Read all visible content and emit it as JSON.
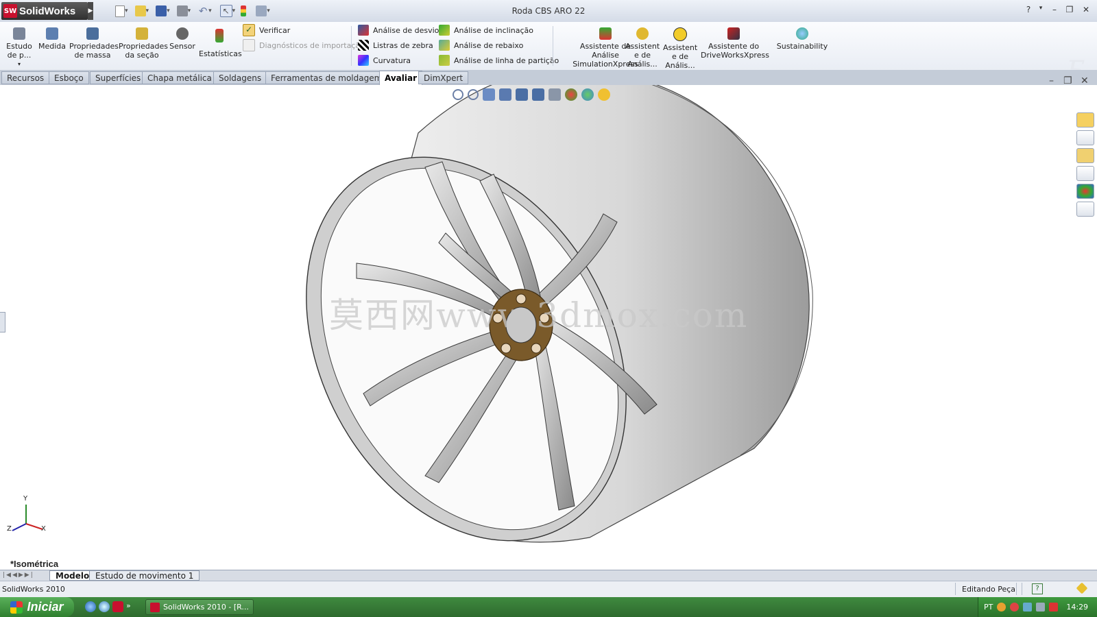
{
  "app": {
    "name": "SolidWorks",
    "logo_badge": "SW",
    "title": "Roda CBS ARO 22"
  },
  "ribbon": {
    "big": [
      {
        "id": "estudo",
        "label": "Estudo\nde p...",
        "icon": "motion-study-icon"
      },
      {
        "id": "medida",
        "label": "Medida",
        "icon": "measure-icon"
      },
      {
        "id": "propmassa",
        "label": "Propriedades\nde massa",
        "icon": "mass-properties-icon"
      },
      {
        "id": "propsecao",
        "label": "Propriedades\nda seção",
        "icon": "section-properties-icon"
      },
      {
        "id": "sensor",
        "label": "Sensor",
        "icon": "sensor-icon"
      },
      {
        "id": "estat",
        "label": "Estatísticas",
        "icon": "statistics-icon"
      }
    ],
    "verify": {
      "verificar": "Verificar",
      "diagnosticos": "Diagnósticos de importação"
    },
    "analysis_col1": [
      "Análise de desvio",
      "Listras de zebra",
      "Curvatura"
    ],
    "analysis_col2": [
      "Análise de inclinação",
      "Análise de rebaixo",
      "Análise de linha de partição"
    ],
    "assist": {
      "sim": "Assistente de\nAnálise\nSimulationXpress",
      "a2": "Assistent\ne de\nAnális...",
      "a3": "Assistent\ne de\nAnális...",
      "drive": "Assistente do\nDriveWorksXpress",
      "sust": "Sustainability"
    }
  },
  "tabs": [
    "Recursos",
    "Esboço",
    "Superfícies",
    "Chapa metálica",
    "Soldagens",
    "Ferramentas de moldagem",
    "Avaliar",
    "DimXpert"
  ],
  "active_tab": "Avaliar",
  "viewport": {
    "watermark": "莫西网www.3dmox.com",
    "view_name": "*Isométrica",
    "axis": {
      "x": "X",
      "y": "Y",
      "z": "Z"
    }
  },
  "bottom_tabs": [
    "Modelo",
    "Estudo de movimento 1"
  ],
  "status": {
    "left": "SolidWorks 2010",
    "mode": "Editando Peça"
  },
  "taskbar": {
    "start": "Iniciar",
    "task": "SolidWorks 2010 - [R...",
    "lang": "PT",
    "time": "14:29"
  },
  "colors": {
    "brand_red": "#c8102e",
    "hub": "#7a5a2a",
    "taskbar_green": "#2e6a2e"
  }
}
